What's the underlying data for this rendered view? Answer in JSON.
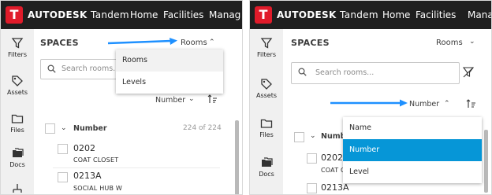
{
  "header": {
    "brand": "AUTODESK",
    "product": "Tandem",
    "nav": [
      "Home",
      "Facilities",
      "Manag"
    ]
  },
  "rail": {
    "items": [
      {
        "label": "Filters",
        "icon": "filter-icon"
      },
      {
        "label": "Assets",
        "icon": "tag-icon"
      },
      {
        "label": "Files",
        "icon": "folder-icon"
      },
      {
        "label": "Docs",
        "icon": "docs-icon"
      }
    ]
  },
  "spaces": {
    "title": "SPACES",
    "search_placeholder": "Search rooms...",
    "column_header": "Number",
    "count": "224 of 224",
    "rows": [
      {
        "code": "0202",
        "name": "COAT CLOSET"
      },
      {
        "code": "0213A",
        "name": "SOCIAL HUB W"
      }
    ],
    "rows_right": [
      {
        "code": "0202",
        "name": "COAT C"
      },
      {
        "code": "0213A",
        "name": ""
      }
    ]
  },
  "left_panel": {
    "selector_value": "Rooms",
    "sort_value": "Number",
    "dropdown_options": [
      "Rooms",
      "Levels"
    ],
    "dropdown_selected": "Rooms"
  },
  "right_panel": {
    "selector_value": "Rooms",
    "sort_value": "Number",
    "dropdown_options": [
      "Name",
      "Number",
      "Level"
    ],
    "dropdown_selected": "Number"
  },
  "colors": {
    "accent": "#0696d7",
    "brand_red": "#e01b2a",
    "topbar": "#1f1f1f"
  }
}
